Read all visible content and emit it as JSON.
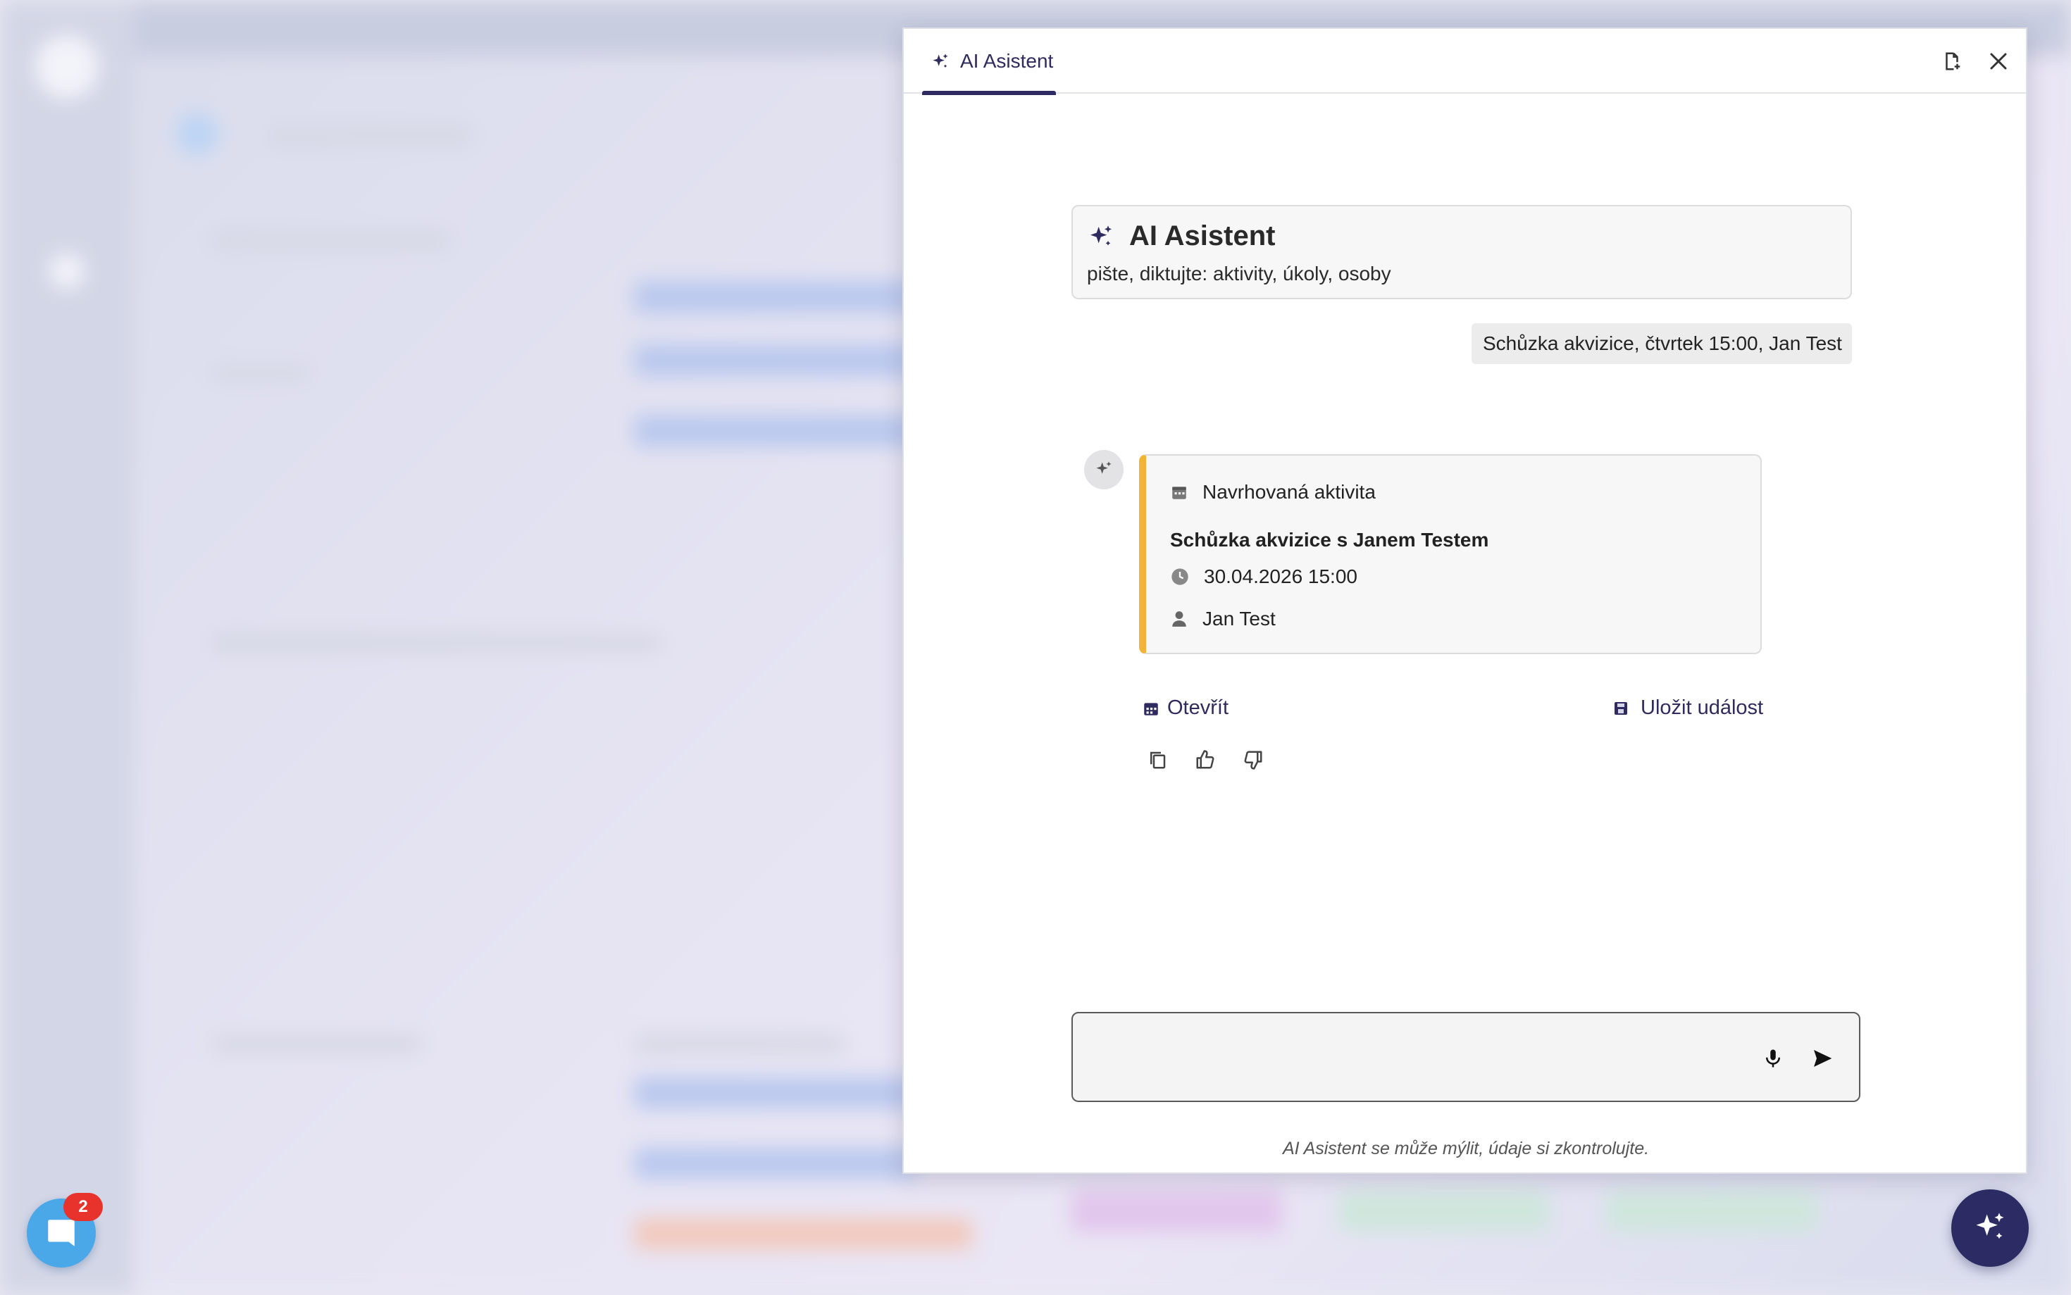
{
  "panel": {
    "tab_label": "AI Asistent",
    "header_actions": [
      "add-note-icon",
      "close-icon"
    ]
  },
  "intro": {
    "title": "AI Asistent",
    "subtitle": "pište, diktujte: aktivity, úkoly, osoby"
  },
  "user_message": "Schůzka akvizice, čtvrtek 15:00, Jan Test",
  "activity": {
    "header": "Navrhovaná aktivita",
    "title": "Schůzka akvizice s Janem Testem",
    "datetime": "30.04.2026 15:00",
    "person": "Jan Test",
    "accent_color": "#f1b536"
  },
  "actions": {
    "open_label": "Otevřít",
    "save_label": "Uložit událost"
  },
  "feedback_icons": [
    "copy-icon",
    "thumbs-up-icon",
    "thumbs-down-icon"
  ],
  "composer": {
    "value": "",
    "placeholder": "",
    "disclaimer": "AI Asistent se může mýlit, údaje si zkontrolujte."
  },
  "chat_widget": {
    "badge_count": "2",
    "color": "#4aa7e8"
  },
  "colors": {
    "brand": "#2d2b64",
    "badge": "#e8322c"
  }
}
